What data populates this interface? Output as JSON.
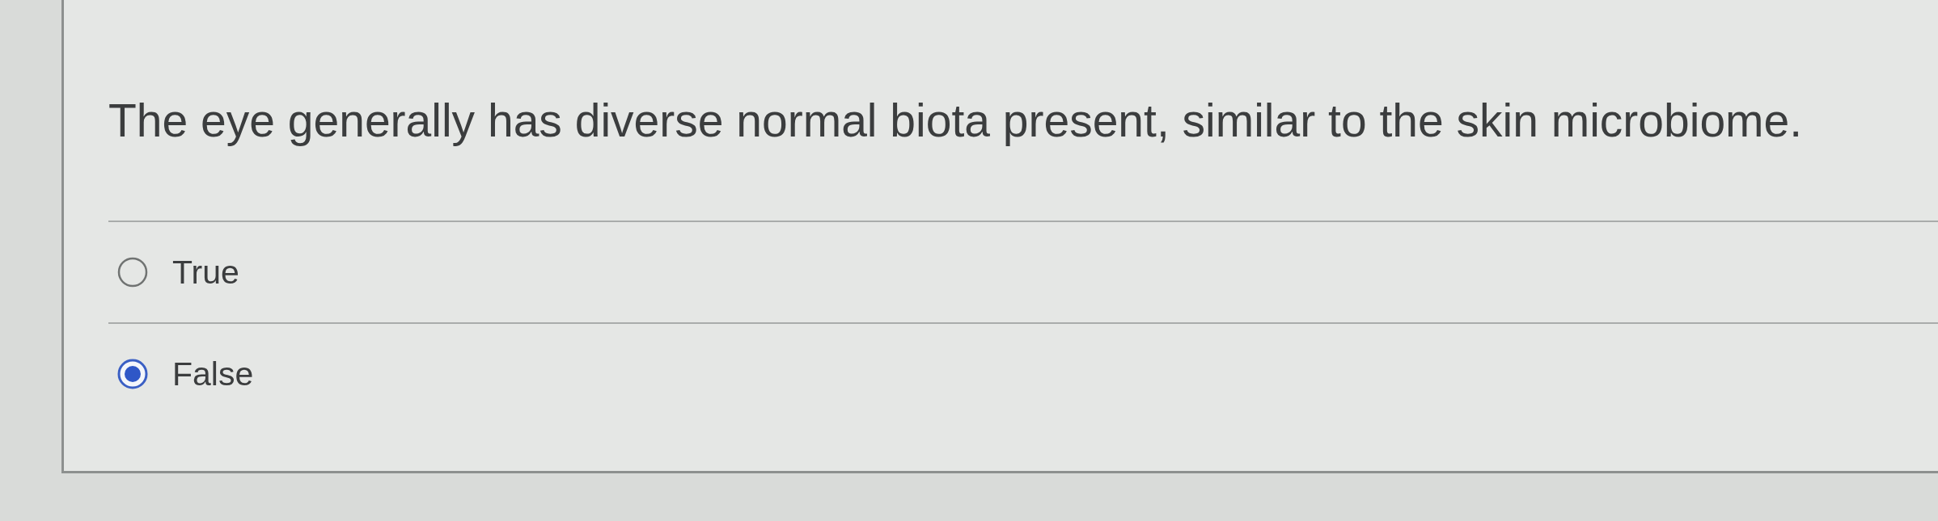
{
  "question": {
    "text": "The eye generally has diverse normal biota present, similar to the skin microbiome."
  },
  "options": [
    {
      "label": "True",
      "selected": false
    },
    {
      "label": "False",
      "selected": true
    }
  ]
}
